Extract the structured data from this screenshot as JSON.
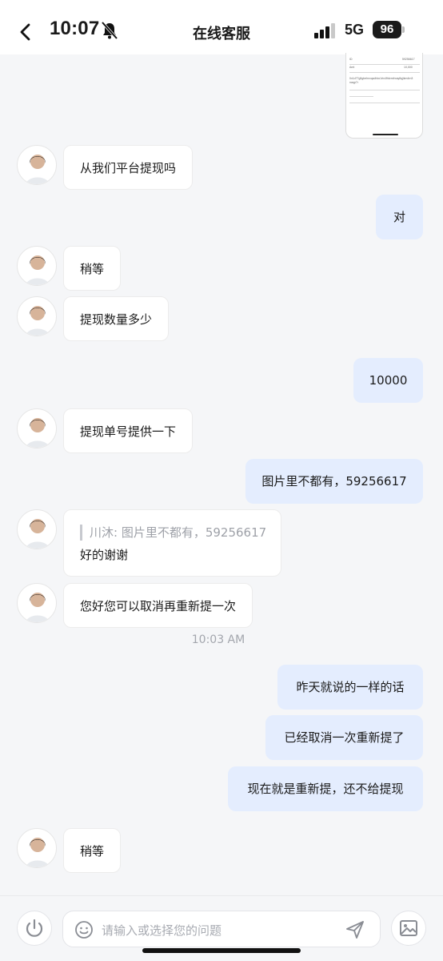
{
  "status": {
    "time": "10:07",
    "network": "5G",
    "battery": "96"
  },
  "header": {
    "title": "在线客服"
  },
  "messages": [
    {
      "side": "in",
      "text": "从我们平台提现吗"
    },
    {
      "side": "out",
      "text": "对"
    },
    {
      "side": "in",
      "text": "稍等"
    },
    {
      "side": "in",
      "text": "提现数量多少"
    },
    {
      "side": "out",
      "text": "10000"
    },
    {
      "side": "in",
      "text": "提现单号提供一下"
    },
    {
      "side": "out",
      "text": "图片里不都有，59256617"
    },
    {
      "side": "in",
      "quote": "川沐: 图片里不都有，59256617",
      "text": "好的谢谢"
    },
    {
      "side": "in",
      "text": "您好您可以取消再重新提一次"
    },
    {
      "side": "out",
      "text": "昨天就说的一样的话"
    },
    {
      "side": "out",
      "text": "已经取消一次重新提了"
    },
    {
      "side": "out",
      "text": "现在就是重新提，还不给提现"
    },
    {
      "side": "in",
      "text": "稍等"
    }
  ],
  "timestamp": "10:03 AM",
  "input": {
    "placeholder": "请输入或选择您的问题"
  },
  "screenshot_card": {
    "row1_value": "59256617",
    "row2_value": "10,000",
    "row3_value": "0x1d77g5gbehnxqsdhbx1rtx4fhkrmfrxay8qjikm4rn3naqp7r"
  }
}
